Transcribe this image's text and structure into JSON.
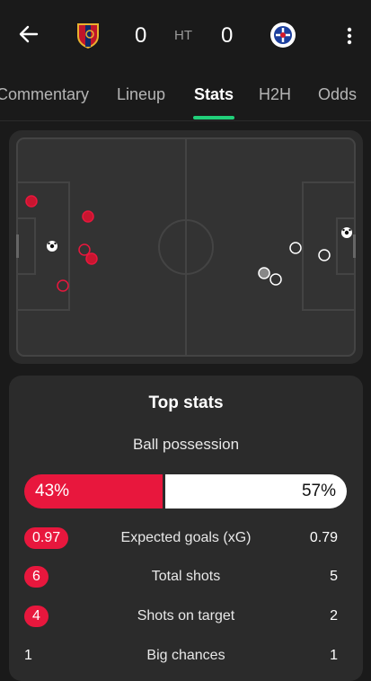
{
  "header": {
    "home_score": "0",
    "away_score": "0",
    "status": "HT",
    "icons": [
      "back-arrow-icon",
      "home-team-crest-icon",
      "away-team-crest-icon",
      "more-vertical-icon"
    ]
  },
  "tabs": [
    {
      "label": "Commentary",
      "active": false
    },
    {
      "label": "Lineup",
      "active": false
    },
    {
      "label": "Stats",
      "active": true
    },
    {
      "label": "H2H",
      "active": false
    },
    {
      "label": "Odds",
      "active": false
    }
  ],
  "colors": {
    "home": "#e8173d",
    "away": "#ffffff",
    "accent": "#21d07a",
    "card": "#2b2b2b",
    "background": "#1a1a1a"
  },
  "top_stats": {
    "title": "Top stats",
    "possession": {
      "label": "Ball possession",
      "home": "43%",
      "away": "57%",
      "home_fraction": 0.43
    },
    "rows": [
      {
        "name": "Expected goals (xG)",
        "home": "0.97",
        "away": "0.79",
        "home_highlight": true
      },
      {
        "name": "Total shots",
        "home": "6",
        "away": "5",
        "home_highlight": true
      },
      {
        "name": "Shots on target",
        "home": "4",
        "away": "2",
        "home_highlight": true
      },
      {
        "name": "Big chances",
        "home": "1",
        "away": "1",
        "home_highlight": false
      }
    ]
  }
}
